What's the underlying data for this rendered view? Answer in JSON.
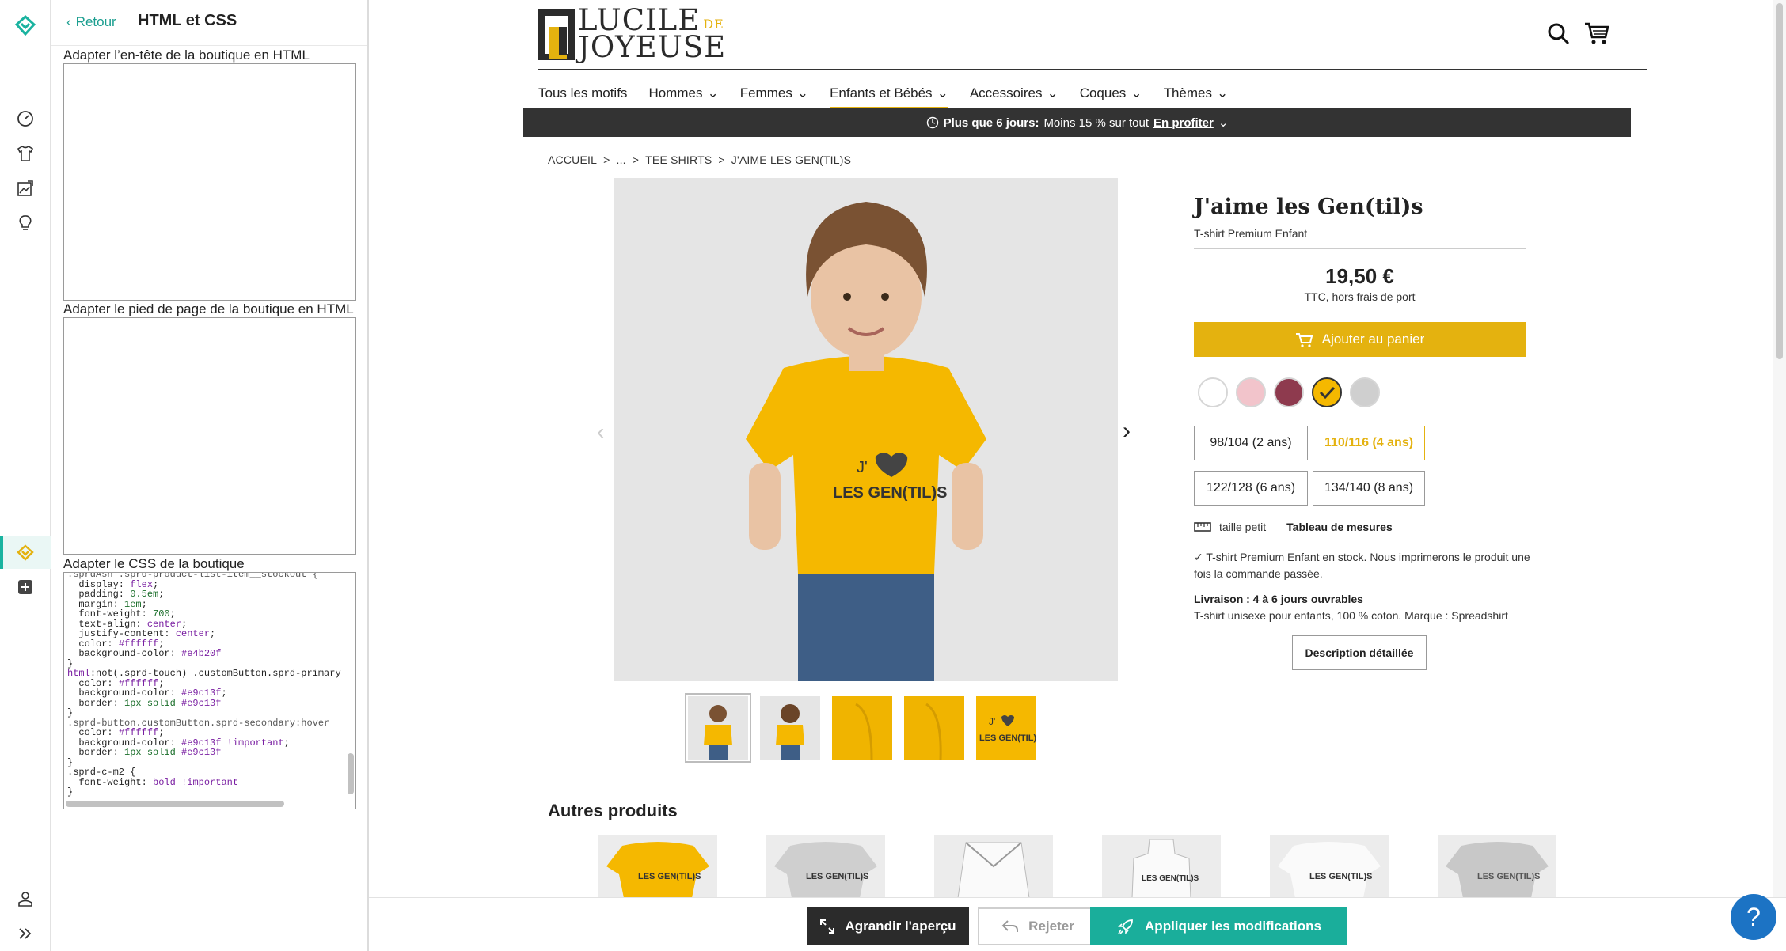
{
  "editor_panel": {
    "back_label": "Retour",
    "title": "HTML et CSS",
    "header_label": "Adapter l’en-tête de la boutique en HTML",
    "footer_label": "Adapter le pied de page de la boutique en HTML",
    "css_label": "Adapter le CSS de la boutique",
    "header_html": "",
    "footer_html": ""
  },
  "shop": {
    "logo_text_1": "LUCILE",
    "logo_text_de": "DE",
    "logo_text_2": "JOYEUSE",
    "nav": [
      "Tous les motifs",
      "Hommes",
      "Femmes",
      "Enfants et Bébés",
      "Accessoires",
      "Coques",
      "Thèmes"
    ],
    "nav_active": "Enfants et Bébés",
    "promo_bold": "Plus que 6 jours:",
    "promo_text": "Moins 15 % sur tout",
    "promo_link": "En profiter",
    "breadcrumb": [
      "ACCUEIL",
      ">",
      "...",
      ">",
      "TEE SHIRTS",
      ">",
      "J'AIME LES GEN(TIL)S"
    ],
    "product_title": "J'aime les Gen(til)s",
    "product_subtitle": "T-shirt Premium Enfant",
    "price": "19,50 €",
    "price_note": "TTC, hors frais de port",
    "add_to_cart": "Ajouter au panier",
    "colors": [
      "#ffffff",
      "#f2c4cb",
      "#8e3a4e",
      "#f5b800",
      "#cfcfcf"
    ],
    "selected_color": "#f5b800",
    "sizes": [
      "98/104 (2 ans)",
      "110/116 (4 ans)",
      "122/128 (6 ans)",
      "134/140 (8 ans)"
    ],
    "selected_size": "110/116 (4 ans)",
    "fit_label": "taille petit",
    "size_chart": "Tableau de mesures",
    "stock_text": "✓ T-shirt Premium Enfant en stock. Nous imprimerons le produit une fois la commande passée.",
    "delivery": "Livraison : 4 à 6 jours ouvrables",
    "description": "T-shirt unisexe pour enfants, 100 % coton. Marque : Spreadshirt",
    "detail_button": "Description détaillée",
    "other_products": "Autres produits",
    "accent": "#e4b20f"
  },
  "actions": {
    "enlarge": "Agrandir l'aperçu",
    "reject": "Rejeter",
    "apply": "Appliquer les modifications",
    "help": "?"
  }
}
